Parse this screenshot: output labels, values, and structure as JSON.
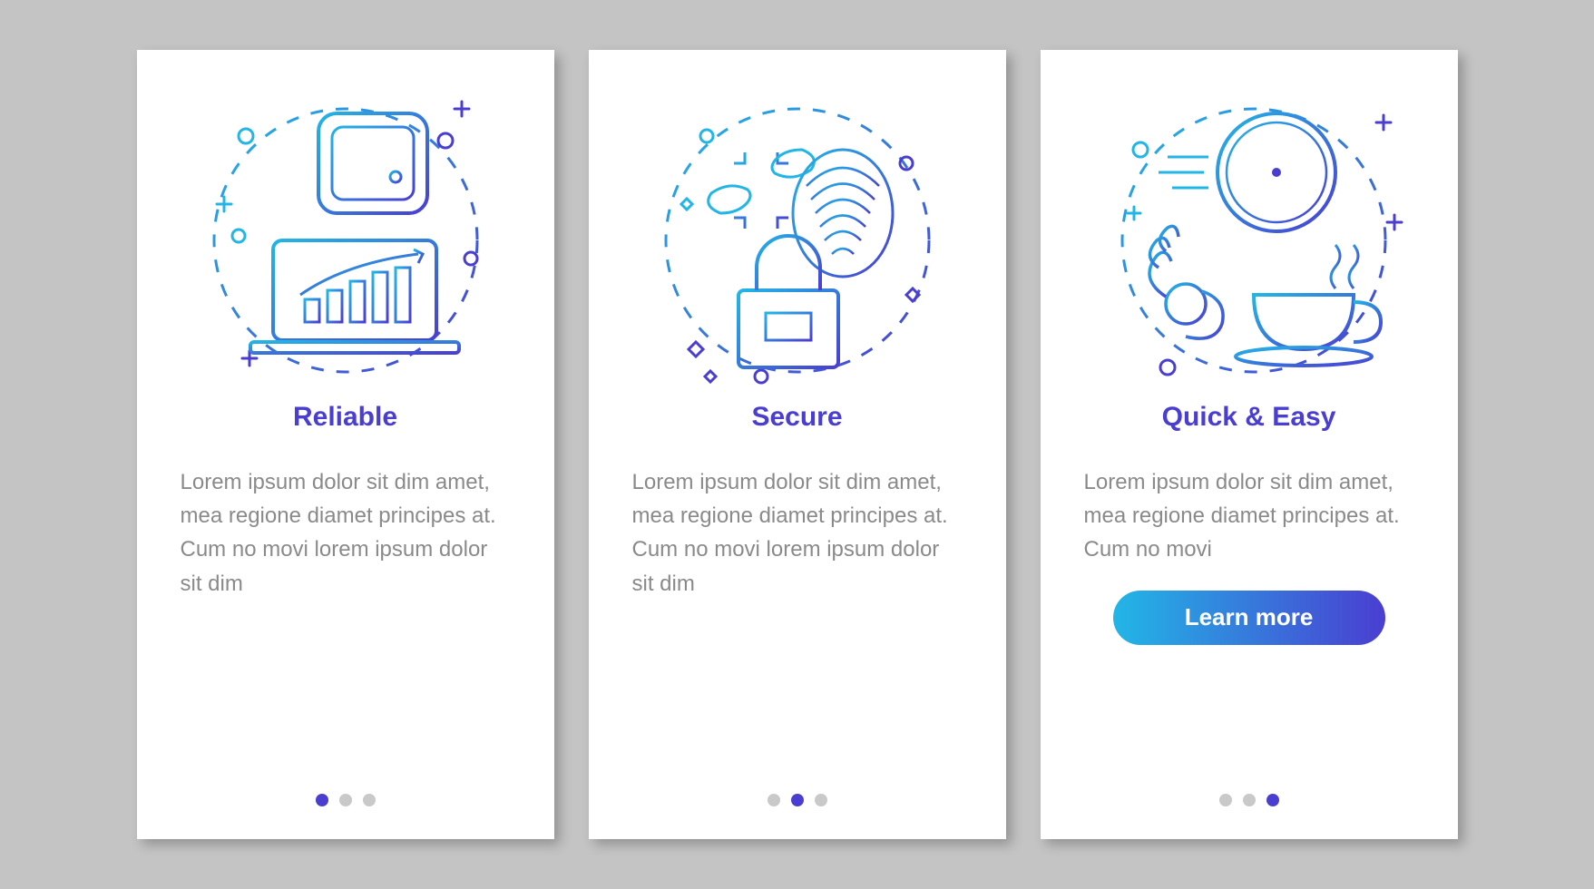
{
  "colors": {
    "title": "#4a3ed1",
    "body": "#8a8a8a",
    "gradient_start": "#22b6e6",
    "gradient_end": "#4a3ed1",
    "dot_inactive": "#c9c9c9",
    "dot_active": "#4a3ed1"
  },
  "cards": [
    {
      "title": "Reliable",
      "body": "Lorem ipsum dolor sit dim amet, mea regione diamet principes at. Cum no movi lorem ipsum dolor sit dim",
      "icon": "reliable-icon",
      "active_dot": 0,
      "has_cta": false
    },
    {
      "title": "Secure",
      "body": "Lorem ipsum dolor sit dim amet, mea regione diamet principes at. Cum no movi lorem ipsum dolor sit dim",
      "icon": "secure-icon",
      "active_dot": 1,
      "has_cta": false
    },
    {
      "title": "Quick & Easy",
      "body": "Lorem ipsum dolor sit dim amet, mea regione diamet principes at. Cum no movi",
      "icon": "quick-easy-icon",
      "active_dot": 2,
      "has_cta": true,
      "cta_label": "Learn more"
    }
  ]
}
